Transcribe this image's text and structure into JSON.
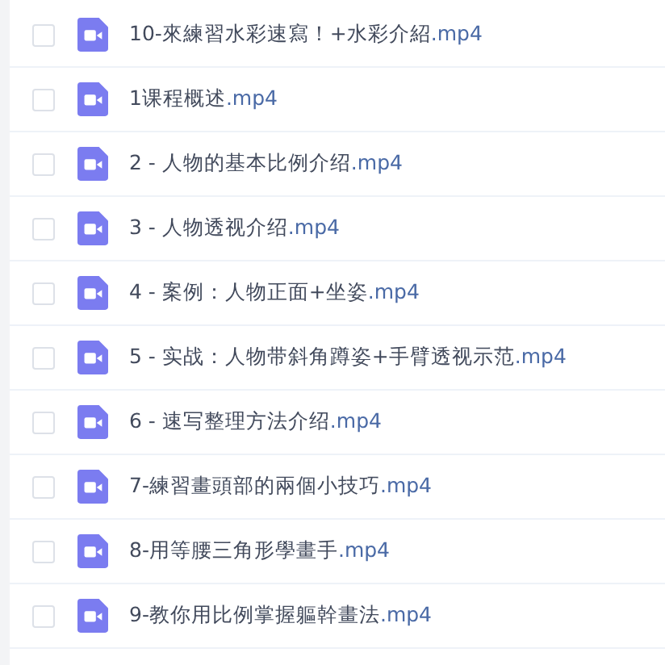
{
  "files": [
    {
      "name": "10-來練習水彩速寫！+水彩介紹",
      "extension": ".mp4",
      "checked": false
    },
    {
      "name": "1课程概述",
      "extension": ".mp4",
      "checked": false
    },
    {
      "name": "2 - 人物的基本比例介绍",
      "extension": ".mp4",
      "checked": false
    },
    {
      "name": "3 - 人物透视介绍",
      "extension": ".mp4",
      "checked": false
    },
    {
      "name": "4 - 案例：人物正面+坐姿",
      "extension": ".mp4",
      "checked": false
    },
    {
      "name": "5 - 实战：人物带斜角蹲姿+手臂透视示范",
      "extension": ".mp4",
      "checked": false
    },
    {
      "name": "6 - 速写整理方法介绍",
      "extension": ".mp4",
      "checked": false
    },
    {
      "name": "7-練習畫頭部的兩個小技巧",
      "extension": ".mp4",
      "checked": false
    },
    {
      "name": "8-用等腰三角形學畫手",
      "extension": ".mp4",
      "checked": false
    },
    {
      "name": "9-教你用比例掌握軀幹畫法",
      "extension": ".mp4",
      "checked": false
    }
  ]
}
